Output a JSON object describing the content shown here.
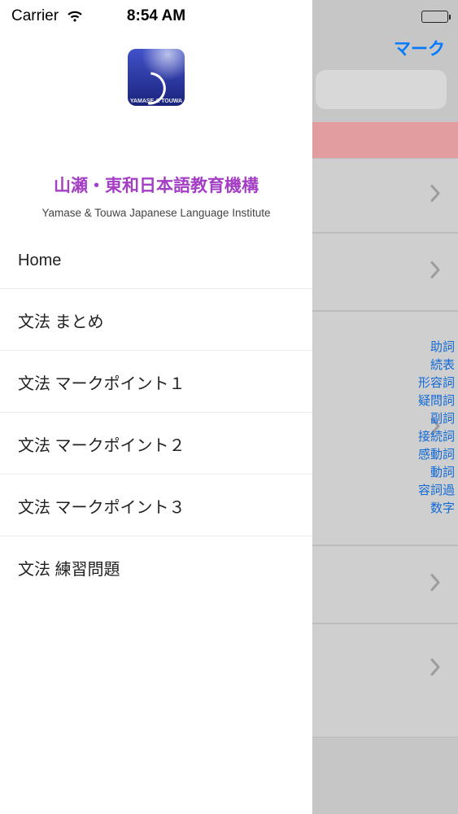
{
  "status_bar": {
    "carrier": "Carrier",
    "time": "8:54 AM"
  },
  "drawer": {
    "logo_caption": "YAMASE & TOUWA",
    "title_jp": "山瀬・東和日本語教育機構",
    "title_en": "Yamase & Touwa Japanese Language Institute",
    "menu": [
      "Home",
      "文法 まとめ",
      "文法 マークポイント１",
      "文法 マークポイント２",
      "文法 マークポイント３",
      "文法 練習問題"
    ]
  },
  "background": {
    "nav_right": "マーク",
    "category_tags": [
      "助詞",
      "続表",
      "形容詞",
      "疑問詞",
      "副詞",
      "接続詞",
      "感動詞",
      "動詞",
      "容詞過",
      "数字"
    ]
  }
}
